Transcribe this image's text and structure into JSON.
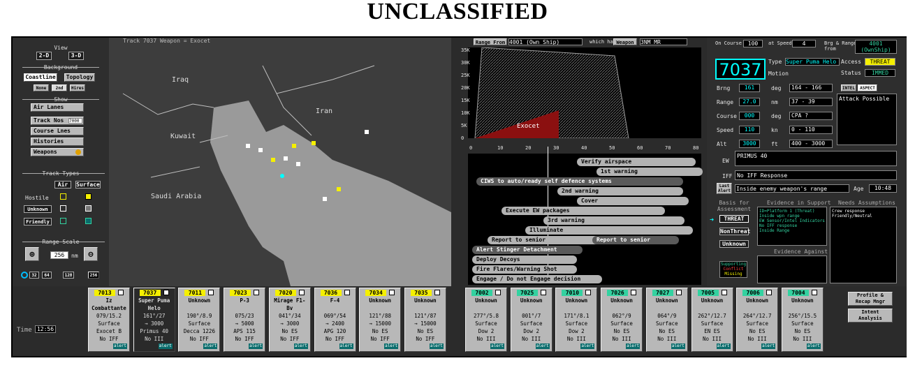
{
  "classification": "UNCLASSIFIED",
  "left_panel": {
    "view_label": "View",
    "view_2d": "2-D",
    "view_3d": "3-D",
    "background_label": "Background",
    "coastline": "Coastline",
    "topology": "Topology",
    "bg_none": "None",
    "bg_mid": "2nd",
    "bg_hi": "Hires",
    "show_label": "Show",
    "air_lanes": "Air Lanes",
    "track_nos": "Track Nos",
    "track_nos_val": "7000",
    "course_lines": "Course Lnes",
    "histories": "Histories",
    "weapons": "Weapons",
    "track_types_label": "Track Types",
    "air": "Air",
    "surface": "Surface",
    "hostile": "Hostile",
    "unknown": "Unknown",
    "friendly": "Friendly",
    "range_scale_label": "Range Scale",
    "range_val": "256",
    "range_unit": "nm",
    "scale_32": "32",
    "scale_64": "64",
    "scale_128": "128",
    "scale_256": "256"
  },
  "map": {
    "header": "Track 7037 Weapon = Exocet",
    "labels": [
      "Iraq",
      "Iran",
      "Kuwait",
      "Saudi Arabia"
    ]
  },
  "profile": {
    "range_from_label": "Range From",
    "range_from_val": "4001 (Own Ship)",
    "which_has_label": "which has",
    "weapon_btn": "Weapon",
    "weapon_range": "3NM MR",
    "alt_ticks": [
      "35K",
      "30K",
      "25K",
      "20K",
      "15K",
      "10K",
      "5K",
      "0"
    ],
    "weapon_label": "Exocet",
    "range_ticks": [
      "0",
      "10",
      "20",
      "30",
      "40",
      "50",
      "60",
      "70",
      "80"
    ]
  },
  "timeline": {
    "bars": [
      "Verify airspace",
      "1st warning",
      "CIWS to auto/ready self defence systems",
      "2nd warning",
      "Cover",
      "Execute EW packages",
      "3rd warning",
      "Illuminate",
      "Report to senior",
      "Report to senior",
      "Alert Stinger Detachment",
      "Deploy Decoys",
      "Fire Flares/Warning Shot",
      "Engage / Do not Engage decision"
    ]
  },
  "right_panel": {
    "on_course_label": "On Course",
    "on_course_val": "100",
    "at_speed_label": "at Speed",
    "at_speed_val": "4",
    "brg_range_label": "Brg & Range from",
    "brg_range_val1": "4001",
    "brg_range_val2": "(OwnShip)",
    "track_no": "7037",
    "type_label": "Type",
    "type_val": "Super Puma Helo",
    "motion_label": "Motion",
    "access_label": "Access",
    "access_val": "THREAT",
    "status_label": "Status",
    "status_val": "IMMED",
    "rows": [
      {
        "label": "Brng",
        "val": "161",
        "unit": "deg",
        "range": "164 - 166"
      },
      {
        "label": "Range",
        "val": "27.0",
        "unit": "nm",
        "range": "37 - 39"
      },
      {
        "label": "Course",
        "val": "000",
        "unit": "deg",
        "range": "CPA ?"
      },
      {
        "label": "Speed",
        "val": "110",
        "unit": "kn",
        "range": "0 - 110"
      },
      {
        "label": "Alt",
        "val": "3000",
        "unit": "ft",
        "range": "400 - 3000"
      }
    ],
    "intel": "INTEL",
    "aspect": "ASPECT",
    "attack_possible": "Attack Possible",
    "ew_label": "EW",
    "ew_val": "PRIMUS 40",
    "iff_label": "IFF",
    "iff_val": "No IFF Response",
    "last_alert": "Last Alert",
    "alert_text": "Inside enemy weapon's range",
    "age_label": "Age",
    "age_val": "10:48",
    "basis_label": "Basis for Assessment",
    "evidence_support_label": "Evidence in Support",
    "needs_assumptions_label": "Needs Assumptions",
    "threat_btn": "THREAT",
    "neutral_btn": "NonThreat",
    "unknown_btn": "Unknown",
    "evidence_lines": [
      "ID=Platform 1 (Threat)",
      "Inside wpn range",
      "EW Sensor/Intel Indicators",
      "No IFF response",
      "Inside Range"
    ],
    "needs_lines": [
      "Crew response",
      "Friendly/Neutral"
    ],
    "evidence_against_label": "Evidence Against",
    "legend": [
      "Supporting",
      "Conflict",
      "Missing"
    ]
  },
  "cards_left": [
    {
      "id": "7013",
      "l1": "Iz",
      "l2": "Combattante",
      "l3": "079/15.2",
      "l4": "Surface",
      "l5": "Exocet B",
      "l6": "No IFF"
    },
    {
      "id": "7037",
      "l1": "Super Puma",
      "l2": "Helo",
      "l3": "161°/27",
      "l4": "→ 3000",
      "l5": "Primus 40",
      "l6": "No III"
    },
    {
      "id": "7011",
      "l1": "Unknown",
      "l2": "",
      "l3": "190°/8.9",
      "l4": "Surface",
      "l5": "Decca 1226",
      "l6": "No IFF"
    },
    {
      "id": "7023",
      "l1": "P-3",
      "l2": "",
      "l3": "075/23",
      "l4": "→ 5000",
      "l5": "APS 115",
      "l6": "No IFF"
    },
    {
      "id": "7020",
      "l1": "Mirage F1-",
      "l2": "Bv",
      "l3": "041°/34",
      "l4": "→ 3000",
      "l5": "No ES",
      "l6": "No IFF"
    },
    {
      "id": "7036",
      "l1": "F-4",
      "l2": "",
      "l3": "069°/54",
      "l4": "→ 2400",
      "l5": "APG 120",
      "l6": "No IFF"
    },
    {
      "id": "7034",
      "l1": "Unknown",
      "l2": "",
      "l3": "121°/88",
      "l4": "→ 15000",
      "l5": "No ES",
      "l6": "No IFF"
    },
    {
      "id": "7035",
      "l1": "Unknown",
      "l2": "",
      "l3": "121°/87",
      "l4": "→ 15000",
      "l5": "No ES",
      "l6": "No IFF"
    }
  ],
  "cards_right": [
    {
      "id": "7002",
      "l1": "Unknown",
      "l2": "",
      "l3": "277°/5.8",
      "l4": "Surface",
      "l5": "Dow 2",
      "l6": "No III"
    },
    {
      "id": "7025",
      "l1": "Unknown",
      "l2": "",
      "l3": "001°/7",
      "l4": "Surface",
      "l5": "Dow 2",
      "l6": "No III"
    },
    {
      "id": "7010",
      "l1": "Unknown",
      "l2": "",
      "l3": "171°/8.1",
      "l4": "Surface",
      "l5": "Dow 2",
      "l6": "No III"
    },
    {
      "id": "7026",
      "l1": "Unknown",
      "l2": "",
      "l3": "062°/9",
      "l4": "Surface",
      "l5": "No ES",
      "l6": "No III"
    },
    {
      "id": "7027",
      "l1": "Unknown",
      "l2": "",
      "l3": "064°/9",
      "l4": "Surface",
      "l5": "No ES",
      "l6": "No III"
    },
    {
      "id": "7005",
      "l1": "Unknown",
      "l2": "",
      "l3": "262°/12.7",
      "l4": "Surface",
      "l5": "EN ES",
      "l6": "No III"
    },
    {
      "id": "7006",
      "l1": "Unknown",
      "l2": "",
      "l3": "264°/12.7",
      "l4": "Surface",
      "l5": "No ES",
      "l6": "No III"
    },
    {
      "id": "7004",
      "l1": "Unknown",
      "l2": "",
      "l3": "256°/15.5",
      "l4": "Surface",
      "l5": "No ES",
      "l6": "No III"
    }
  ],
  "alerts_label": "alert",
  "time_label": "Time",
  "time_val": "12:56",
  "profile_btn": "Profile & Recap Mngr",
  "intent_btn": "Intent Analysis",
  "colors": {
    "threat_yellow": "#f5f000",
    "friend_green": "#33d2a0",
    "track_cyan": "#00ffff",
    "weapon_red": "#8b1010"
  }
}
